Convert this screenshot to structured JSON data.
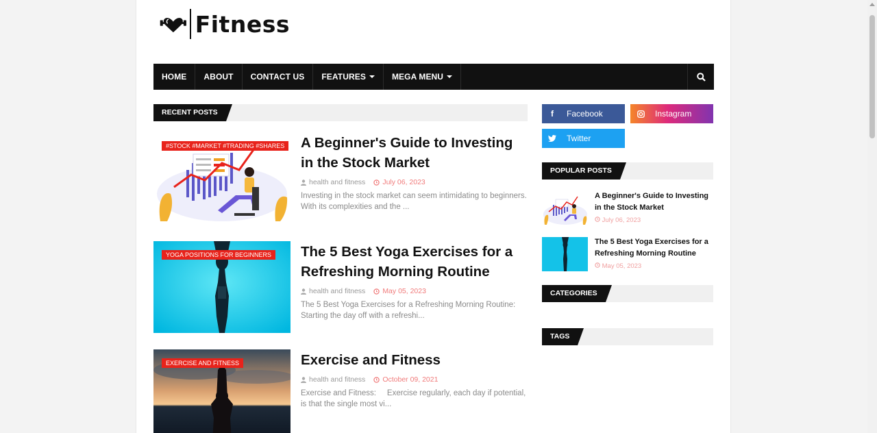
{
  "brand": {
    "name": "Fitness",
    "logo_icon": "heart-dumbbell-icon"
  },
  "nav": {
    "items": [
      {
        "label": "HOME",
        "dropdown": false
      },
      {
        "label": "ABOUT",
        "dropdown": false
      },
      {
        "label": "CONTACT US",
        "dropdown": false
      },
      {
        "label": "FEATURES",
        "dropdown": true
      },
      {
        "label": "MEGA MENU",
        "dropdown": true
      }
    ],
    "search_icon": "search-icon"
  },
  "recent_posts": {
    "heading": "RECENT POSTS",
    "posts": [
      {
        "label": "#STOCK #MARKET #TRADING #SHARES",
        "title": "A Beginner's Guide to Investing in the Stock Market",
        "author": "health and fitness",
        "date": "July 06, 2023",
        "snippet": "Investing in the stock market can seem intimidating to beginners. With its complexities and the ..."
      },
      {
        "label": "YOGA POSITIONS FOR BEGINNERS",
        "title": "The 5 Best Yoga Exercises for a Refreshing Morning Routine",
        "author": "health and fitness",
        "date": "May 05, 2023",
        "snippet": "The 5 Best Yoga Exercises for a Refreshing Morning Routine: Starting the day off with a refreshi..."
      },
      {
        "label": "EXERCISE AND FITNESS",
        "title": "Exercise and Fitness",
        "author": "health and fitness",
        "date": "October 09, 2021",
        "snippet": "Exercise and Fitness:     Exercise regularly, each day if potential, is that the single most vi..."
      }
    ]
  },
  "social": [
    {
      "label": "Facebook",
      "icon": "facebook-icon",
      "color": "#3b5998"
    },
    {
      "label": "Instagram",
      "icon": "instagram-icon",
      "color": "#e1306c"
    },
    {
      "label": "Twitter",
      "icon": "twitter-icon",
      "color": "#1da1f2"
    }
  ],
  "popular_posts": {
    "heading": "POPULAR POSTS",
    "items": [
      {
        "title": "A Beginner's Guide to Investing in the Stock Market",
        "date": "July 06, 2023"
      },
      {
        "title": "The 5 Best Yoga Exercises for a Refreshing Morning Routine",
        "date": "May 05, 2023"
      }
    ]
  },
  "categories": {
    "heading": "CATEGORIES"
  },
  "tags": {
    "heading": "TAGS"
  },
  "colors": {
    "accent": "#e8231b",
    "nav_bg": "#111111",
    "date": "#f07a7a"
  }
}
